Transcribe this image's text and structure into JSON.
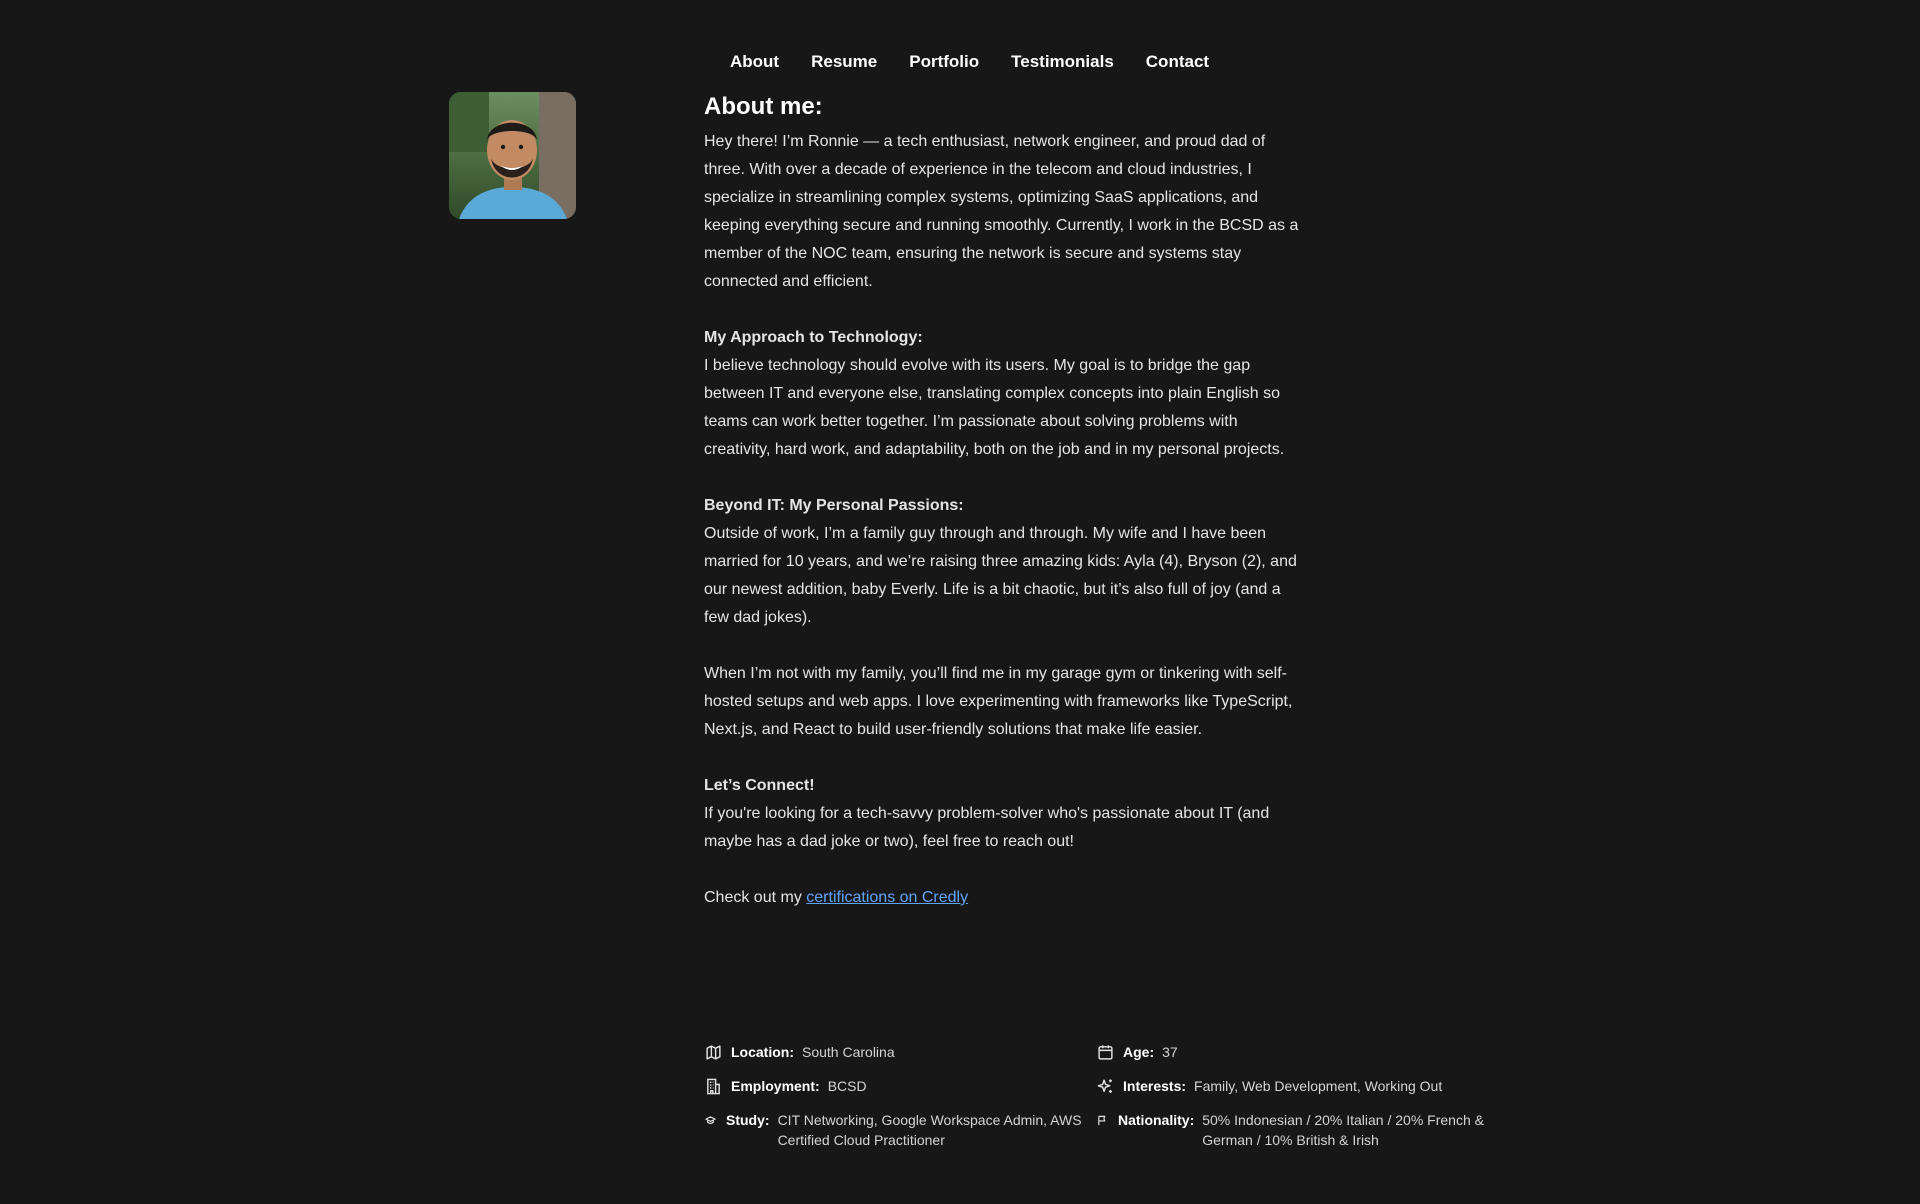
{
  "nav": {
    "items": [
      "About",
      "Resume",
      "Portfolio",
      "Testimonials",
      "Contact"
    ]
  },
  "avatar": {
    "alt": "avatar"
  },
  "about": {
    "heading": "About me:",
    "intro": "Hey there! I’m Ronnie — a tech enthusiast, network engineer, and proud dad of three. With over a decade of experience in the telecom and cloud industries, I specialize in streamlining complex systems, optimizing SaaS applications, and keeping everything secure and running smoothly. Currently, I work in the BCSD as a member of the NOC team, ensuring the network is secure and systems stay connected and efficient.",
    "approach_title": "My Approach to Technology:",
    "approach_text": "I believe technology should evolve with its users. My goal is to bridge the gap between IT and everyone else, translating complex concepts into plain English so teams can work better together. I’m passionate about solving problems with creativity, hard work, and adaptability, both on the job and in my personal projects.",
    "beyond_title": "Beyond IT: My Personal Passions:",
    "beyond_text": "Outside of work, I’m a family guy through and through. My wife and I have been married for 10 years, and we’re raising three amazing kids: Ayla (4), Bryson (2), and our newest addition, baby Everly. Life is a bit chaotic, but it’s also full of joy (and a few dad jokes).",
    "hobbies_text": "When I’m not with my family, you’ll find me in my garage gym or tinkering with self-hosted setups and web apps. I love experimenting with frameworks like TypeScript, Next.js, and React to build user-friendly solutions that make life easier.",
    "connect_title": "Let’s Connect!",
    "connect_text": "If you're looking for a tech-savvy problem-solver who's passionate about IT (and maybe has a dad joke or two), feel free to reach out!",
    "cert_prefix": "Check out my ",
    "cert_link": "certifications on Credly"
  },
  "info": {
    "location_label": "Location:",
    "location_value": "South Carolina",
    "age_label": "Age:",
    "age_value": "37",
    "employment_label": "Employment:",
    "employment_value": "BCSD",
    "interests_label": "Interests:",
    "interests_value": "Family, Web Development, Working Out",
    "study_label": "Study:",
    "study_value": "CIT Networking, Google Workspace Admin, AWS Certified Cloud Practitioner",
    "nationality_label": "Nationality:",
    "nationality_value": "50% Indonesian / 20% Italian / 20% French & German / 10% British & Irish"
  },
  "icons": {
    "location": "map-icon",
    "age": "calendar-icon",
    "employment": "building-icon",
    "interests": "sparkles-icon",
    "study": "graduation-cap-icon",
    "nationality": "flag-icon"
  },
  "colors": {
    "background": "#171717",
    "link": "#60a5fa"
  }
}
